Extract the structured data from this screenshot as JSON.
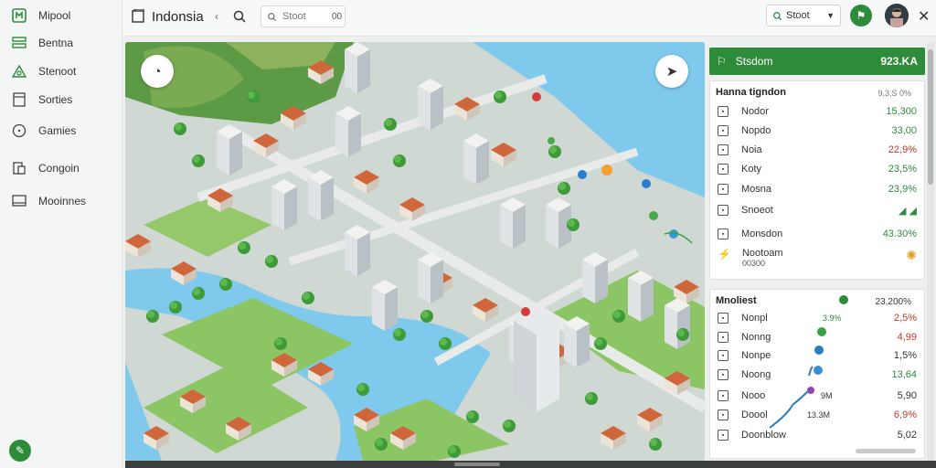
{
  "sidebar": {
    "items": [
      {
        "label": "Mipool",
        "icon": "app-logo-icon"
      },
      {
        "label": "Bentna",
        "icon": "layers-icon"
      },
      {
        "label": "Stenoot",
        "icon": "triangle-icon"
      },
      {
        "label": "Sorties",
        "icon": "document-icon"
      },
      {
        "label": "Gamies",
        "icon": "circle-icon"
      },
      {
        "label": "Congoin",
        "icon": "copy-icon"
      },
      {
        "label": "Mooinnes",
        "icon": "monitor-icon"
      }
    ],
    "fab_icon": "edit-icon"
  },
  "header": {
    "title": "Indonsia",
    "search_placeholder": "Stoot",
    "search_stepper": "00",
    "select_value": "Stoot",
    "accent": "#2e8b3a"
  },
  "panel": {
    "head": {
      "label": "Stsdom",
      "value": "923.KA"
    },
    "card1": {
      "title": "Hanna tigndon",
      "title_value": "9,3,S 0%",
      "rows": [
        {
          "label": "Nodor",
          "value": "15,300",
          "color": "#2e8b3a"
        },
        {
          "label": "Nopdo",
          "value": "33,00",
          "color": "#2e8b3a"
        },
        {
          "label": "Noia",
          "value": "22,9%",
          "color": "#c0392b"
        },
        {
          "label": "Koty",
          "value": "23,5%",
          "color": "#2e8b3a"
        },
        {
          "label": "Mosna",
          "value": "23,9%",
          "color": "#2e8b3a"
        },
        {
          "label": "Snoeot",
          "value": "◢ ◢",
          "color": "#2e8b3a"
        },
        {
          "label": "Monsdon",
          "value": "43.30%",
          "color": "#2e8b3a"
        }
      ],
      "footer": {
        "title": "Nootoam",
        "sub": "00300"
      }
    },
    "card2": {
      "title": "Mnoliest",
      "title_value": "23,200%",
      "rows": [
        {
          "label": "Nonpl",
          "mid": "3.9%",
          "value": "2,5%",
          "color": "#c0392b"
        },
        {
          "label": "Nonng",
          "mid": "",
          "value": "4,99",
          "color": "#c0392b"
        },
        {
          "label": "Nonpe",
          "mid": "",
          "value": "1,5%",
          "color": "#333"
        },
        {
          "label": "Noong",
          "mid": "",
          "value": "13,64",
          "color": "#2e8b3a"
        },
        {
          "label": "Nooo",
          "mid": "9M",
          "value": "5,90",
          "color": "#333"
        },
        {
          "label": "Doool",
          "mid": "13.3M",
          "value": "6,9%",
          "color": "#c0392b"
        },
        {
          "label": "Doonblow",
          "mid": "",
          "value": "5,02",
          "color": "#333"
        }
      ]
    }
  }
}
